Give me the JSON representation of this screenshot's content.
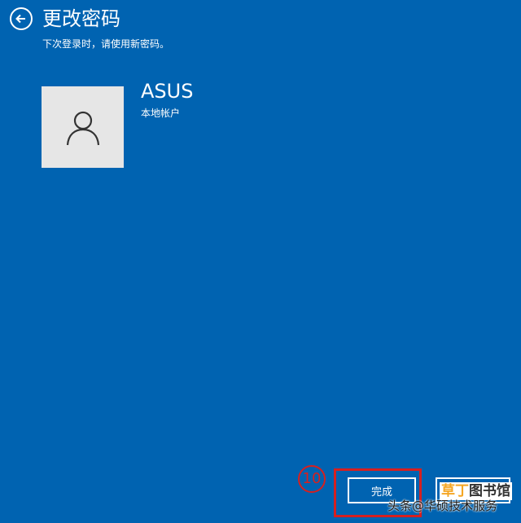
{
  "header": {
    "title": "更改密码",
    "subtitle": "下次登录时，请使用新密码。"
  },
  "account": {
    "name": "ASUS",
    "type": "本地帐户",
    "avatar_icon": "person-icon"
  },
  "actions": {
    "done_label": "完成"
  },
  "annotation": {
    "step_number": "10"
  },
  "watermarks": {
    "right_accent": "草丁",
    "right_rest": "图书馆",
    "bottom": "头条@华硕技术服务"
  },
  "colors": {
    "background": "#0063b1",
    "highlight": "#d62020"
  }
}
